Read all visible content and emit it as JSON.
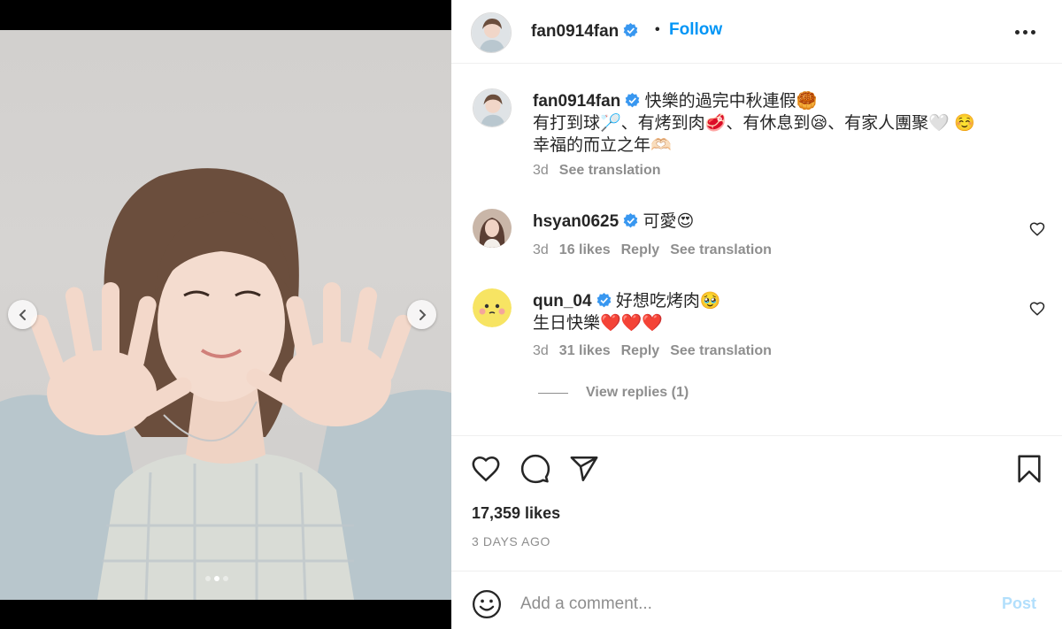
{
  "post": {
    "username": "fan0914fan",
    "follow_label": "Follow",
    "separator": "•"
  },
  "caption": {
    "username": "fan0914fan",
    "lines": [
      "快樂的過完中秋連假🥮",
      "有打到球🏸、有烤到肉🥩、有休息到😪、有家人團聚🤍 ☺️",
      "幸福的而立之年🫶🏻"
    ],
    "time": "3d",
    "see_translation": "See translation"
  },
  "comments": [
    {
      "username": "hsyan0625",
      "text": "可愛😍",
      "time": "3d",
      "likes": "16 likes",
      "reply": "Reply",
      "see_translation": "See translation"
    },
    {
      "username": "qun_04",
      "text": "好想吃烤肉🥹",
      "text2": "生日快樂❤️❤️❤️",
      "time": "3d",
      "likes": "31 likes",
      "reply": "Reply",
      "see_translation": "See translation",
      "view_replies": "View replies (1)"
    }
  ],
  "stats": {
    "likes": "17,359 likes",
    "date": "3 DAYS AGO"
  },
  "add_comment": {
    "placeholder": "Add a comment...",
    "post_label": "Post"
  },
  "carousel": {
    "total": 3,
    "current": 2
  },
  "colors": {
    "link_blue": "#0095f6",
    "post_disabled": "#b2dffc",
    "muted": "#8e8e8e",
    "text": "#262626",
    "verified": "#3897f0"
  },
  "icons": {
    "like": "heart-icon",
    "comment": "comment-icon",
    "share": "paper-plane-icon",
    "save": "bookmark-icon",
    "emoji": "smiley-icon",
    "more": "more-options-icon"
  }
}
